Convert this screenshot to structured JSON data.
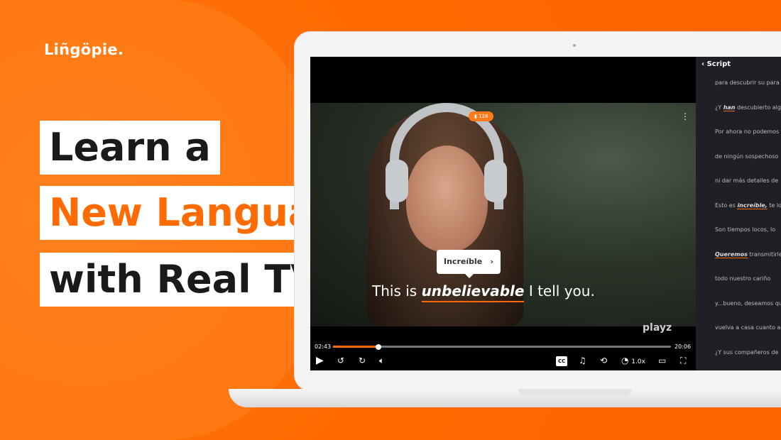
{
  "brand": {
    "logo": "Liñgöpie.",
    "accent": "#ff6b00"
  },
  "headline": {
    "line1": "Learn a",
    "line2": "New Language",
    "line3": "with Real TV!"
  },
  "player": {
    "word_badge_count": "128",
    "menu_icon": "kebab-icon",
    "tooltip": {
      "word": "Increíble",
      "icon": "chevron-right-icon"
    },
    "subtitle": {
      "before": "This is ",
      "highlight": "unbelievable",
      "after": " I tell you."
    },
    "watermark": "playz",
    "current_time": "02:43",
    "duration": "20:06",
    "progress_pct": 13.5,
    "controls": {
      "cc_label": "CC",
      "speed": "1.0x"
    }
  },
  "script": {
    "title": "Script",
    "lines": [
      {
        "pre": "para descubrir su para",
        "hl": "",
        "post": ""
      },
      {
        "pre": "¿Y ",
        "hl": "han",
        "post": " descubierto alg"
      },
      {
        "pre": "Por ahora no podemos",
        "hl": "",
        "post": ""
      },
      {
        "pre": "de ningún sospechoso",
        "hl": "",
        "post": ""
      },
      {
        "pre": "ni dar más detalles de",
        "hl": "",
        "post": ""
      },
      {
        "pre": "Esto es ",
        "hl": "increíble,",
        "post": " te lo"
      },
      {
        "pre": "Son tiempos locos, lo",
        "hl": "",
        "post": ""
      },
      {
        "pre": "",
        "hl": "Queremos",
        "post": " transmitirle"
      },
      {
        "pre": "todo nuestro cariño",
        "hl": "",
        "post": ""
      },
      {
        "pre": "y...bueno, deseamos qu",
        "hl": "",
        "post": ""
      },
      {
        "pre": "vuelva a casa cuanto a",
        "hl": "",
        "post": ""
      },
      {
        "pre": "¿Y sus compañeros de",
        "hl": "",
        "post": ""
      }
    ]
  }
}
